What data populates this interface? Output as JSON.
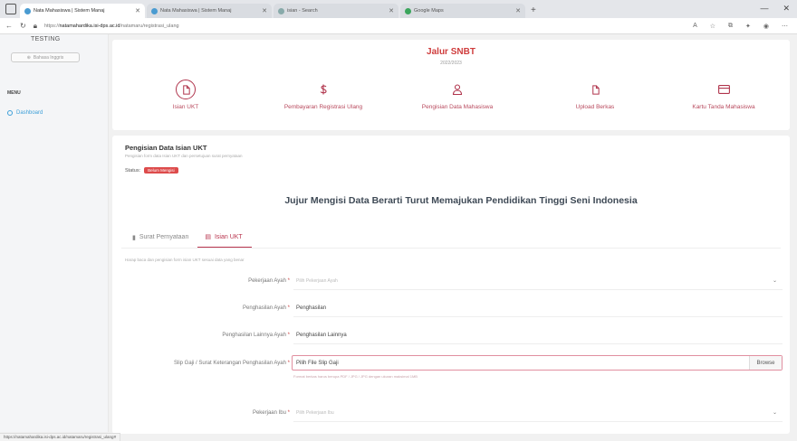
{
  "browser": {
    "tabs": [
      {
        "label": "Nata Mahasiswa | Sistem Manaj",
        "active": true
      },
      {
        "label": "Nata Mahasiswa | Sistem Manaj",
        "active": false
      },
      {
        "label": "isian - Search",
        "active": false
      },
      {
        "label": "Google Maps",
        "active": false
      }
    ],
    "new_tab": "+",
    "url_prefix": "https://",
    "url_host": "natamahardika.isi-dps.ac.id",
    "url_path": "/natamaru/registrasi_ulang",
    "status_url": "https://natamahardika.isi-dps.ac.id/natamaru/registrasi_ulang#"
  },
  "sidebar": {
    "brand": "TESTING",
    "lang_label": "Bahasa Inggris",
    "menu_header": "MENU",
    "items": [
      {
        "label": "Dashboard"
      }
    ]
  },
  "steps": {
    "title": "Jalur SNBT",
    "subtitle": "2022/2023",
    "items": [
      {
        "label": "Isian UKT",
        "icon": "document-icon",
        "active": true
      },
      {
        "label": "Pembayaran Registrasi Ulang",
        "icon": "dollar-icon",
        "active": false
      },
      {
        "label": "Pengisian Data Mahasiswa",
        "icon": "user-icon",
        "active": false
      },
      {
        "label": "Upload Berkas",
        "icon": "document-icon",
        "active": false
      },
      {
        "label": "Kartu Tanda Mahasiswa",
        "icon": "card-icon",
        "active": false
      }
    ]
  },
  "section": {
    "title": "Pengisian Data Isian UKT",
    "subtitle": "Pengisian form data Isian UKT dan persetujuan surat pernyataan",
    "status_label": "Status:",
    "status_badge": "Belum Mengisi",
    "motto": "Jujur Mengisi Data Berarti Turut Memajukan Pendidikan Tinggi Seni Indonesia"
  },
  "form_tabs": [
    {
      "label": "Surat Pernyataan",
      "active": false
    },
    {
      "label": "Isian UKT",
      "active": true
    }
  ],
  "help_text": "Harap baca dan pengisian form isian UKT sesuai data yang benar",
  "fields": [
    {
      "label": "Pekerjaan Ayah",
      "placeholder": "Pilih Pekerjaan Ayah",
      "value": "",
      "type": "select"
    },
    {
      "label": "Penghasilan Ayah",
      "placeholder": "",
      "value": "Penghasilan",
      "type": "text"
    },
    {
      "label": "Penghasilan Lainnya Ayah",
      "placeholder": "",
      "value": "Penghasilan Lainnya",
      "type": "text"
    },
    {
      "label": "Pekerjaan Ibu",
      "placeholder": "Pilih Pekerjaan Ibu",
      "value": "",
      "type": "select"
    }
  ],
  "file_field": {
    "label": "Slip Gaji / Surat Keterangan Penghasilan Ayah",
    "value": "Pilih File Slip Gaji",
    "button": "Browse",
    "hint": "Format berkas harus berupa PDF / JPG / JPG dengan ukuran maksimal 1MB"
  },
  "colors": {
    "accent": "#b9364f",
    "brand": "#cf3d3d",
    "badge": "#dd4b4b",
    "link": "#3d9fd8"
  }
}
